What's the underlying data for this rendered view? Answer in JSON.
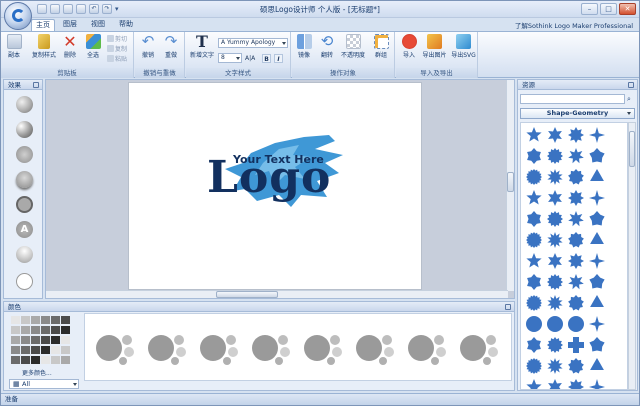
{
  "window": {
    "title": "硕思Logo设计师 个人版 - [无标题*]",
    "minimize": "–",
    "maximize": "□",
    "close": "✕"
  },
  "qat": {
    "undo_glyph": "↶",
    "redo_glyph": "↷",
    "more_glyph": "▾"
  },
  "tabs": [
    {
      "label": "主页"
    },
    {
      "label": "图层"
    },
    {
      "label": "视图"
    },
    {
      "label": "帮助"
    }
  ],
  "promo_link": "了解Sothink Logo Maker Professional",
  "ribbon": {
    "clipboard": {
      "label": "剪贴板",
      "paste": "副本",
      "format_painter": "复制样式",
      "delete": "删除",
      "select_all": "全选",
      "cut": "剪切",
      "copy": "复制",
      "paste_small": "粘贴"
    },
    "undo": {
      "label": "撤销与重做",
      "undo": "撤销",
      "redo": "重做"
    },
    "text": {
      "label": "文字样式",
      "new_text": "新增文字",
      "font": "A Yummy Apology",
      "size": "8",
      "size_unit": "A|A",
      "bold": "B",
      "italic": "I"
    },
    "object": {
      "label": "操作对象",
      "mirror": "镜像",
      "flip": "翻转",
      "opacity": "不透明度",
      "group": "群组"
    },
    "import_export": {
      "label": "导入及导出",
      "import": "导入",
      "export_image": "导出图片",
      "export_svg": "导出SVG"
    }
  },
  "effects_panel": {
    "title": "效果",
    "letter_effect": "A"
  },
  "canvas": {
    "logo_tagline": "Your Text Here",
    "logo_main": "Logo"
  },
  "resources_panel": {
    "title": "资源",
    "search_placeholder": "",
    "search_glyph": "⌕",
    "category": "Shape-Geometry"
  },
  "colors_panel": {
    "title": "颜色",
    "more_colors": "更多颜色...",
    "palette_filter": "All"
  },
  "status": {
    "text": "准备"
  },
  "colors": {
    "accent": "#2e74c8",
    "shape_blue": "#3a73c2",
    "logo_dark": "#12305f",
    "logo_splash": "#2f8fd3",
    "style_gray": "#9a9a9a"
  }
}
